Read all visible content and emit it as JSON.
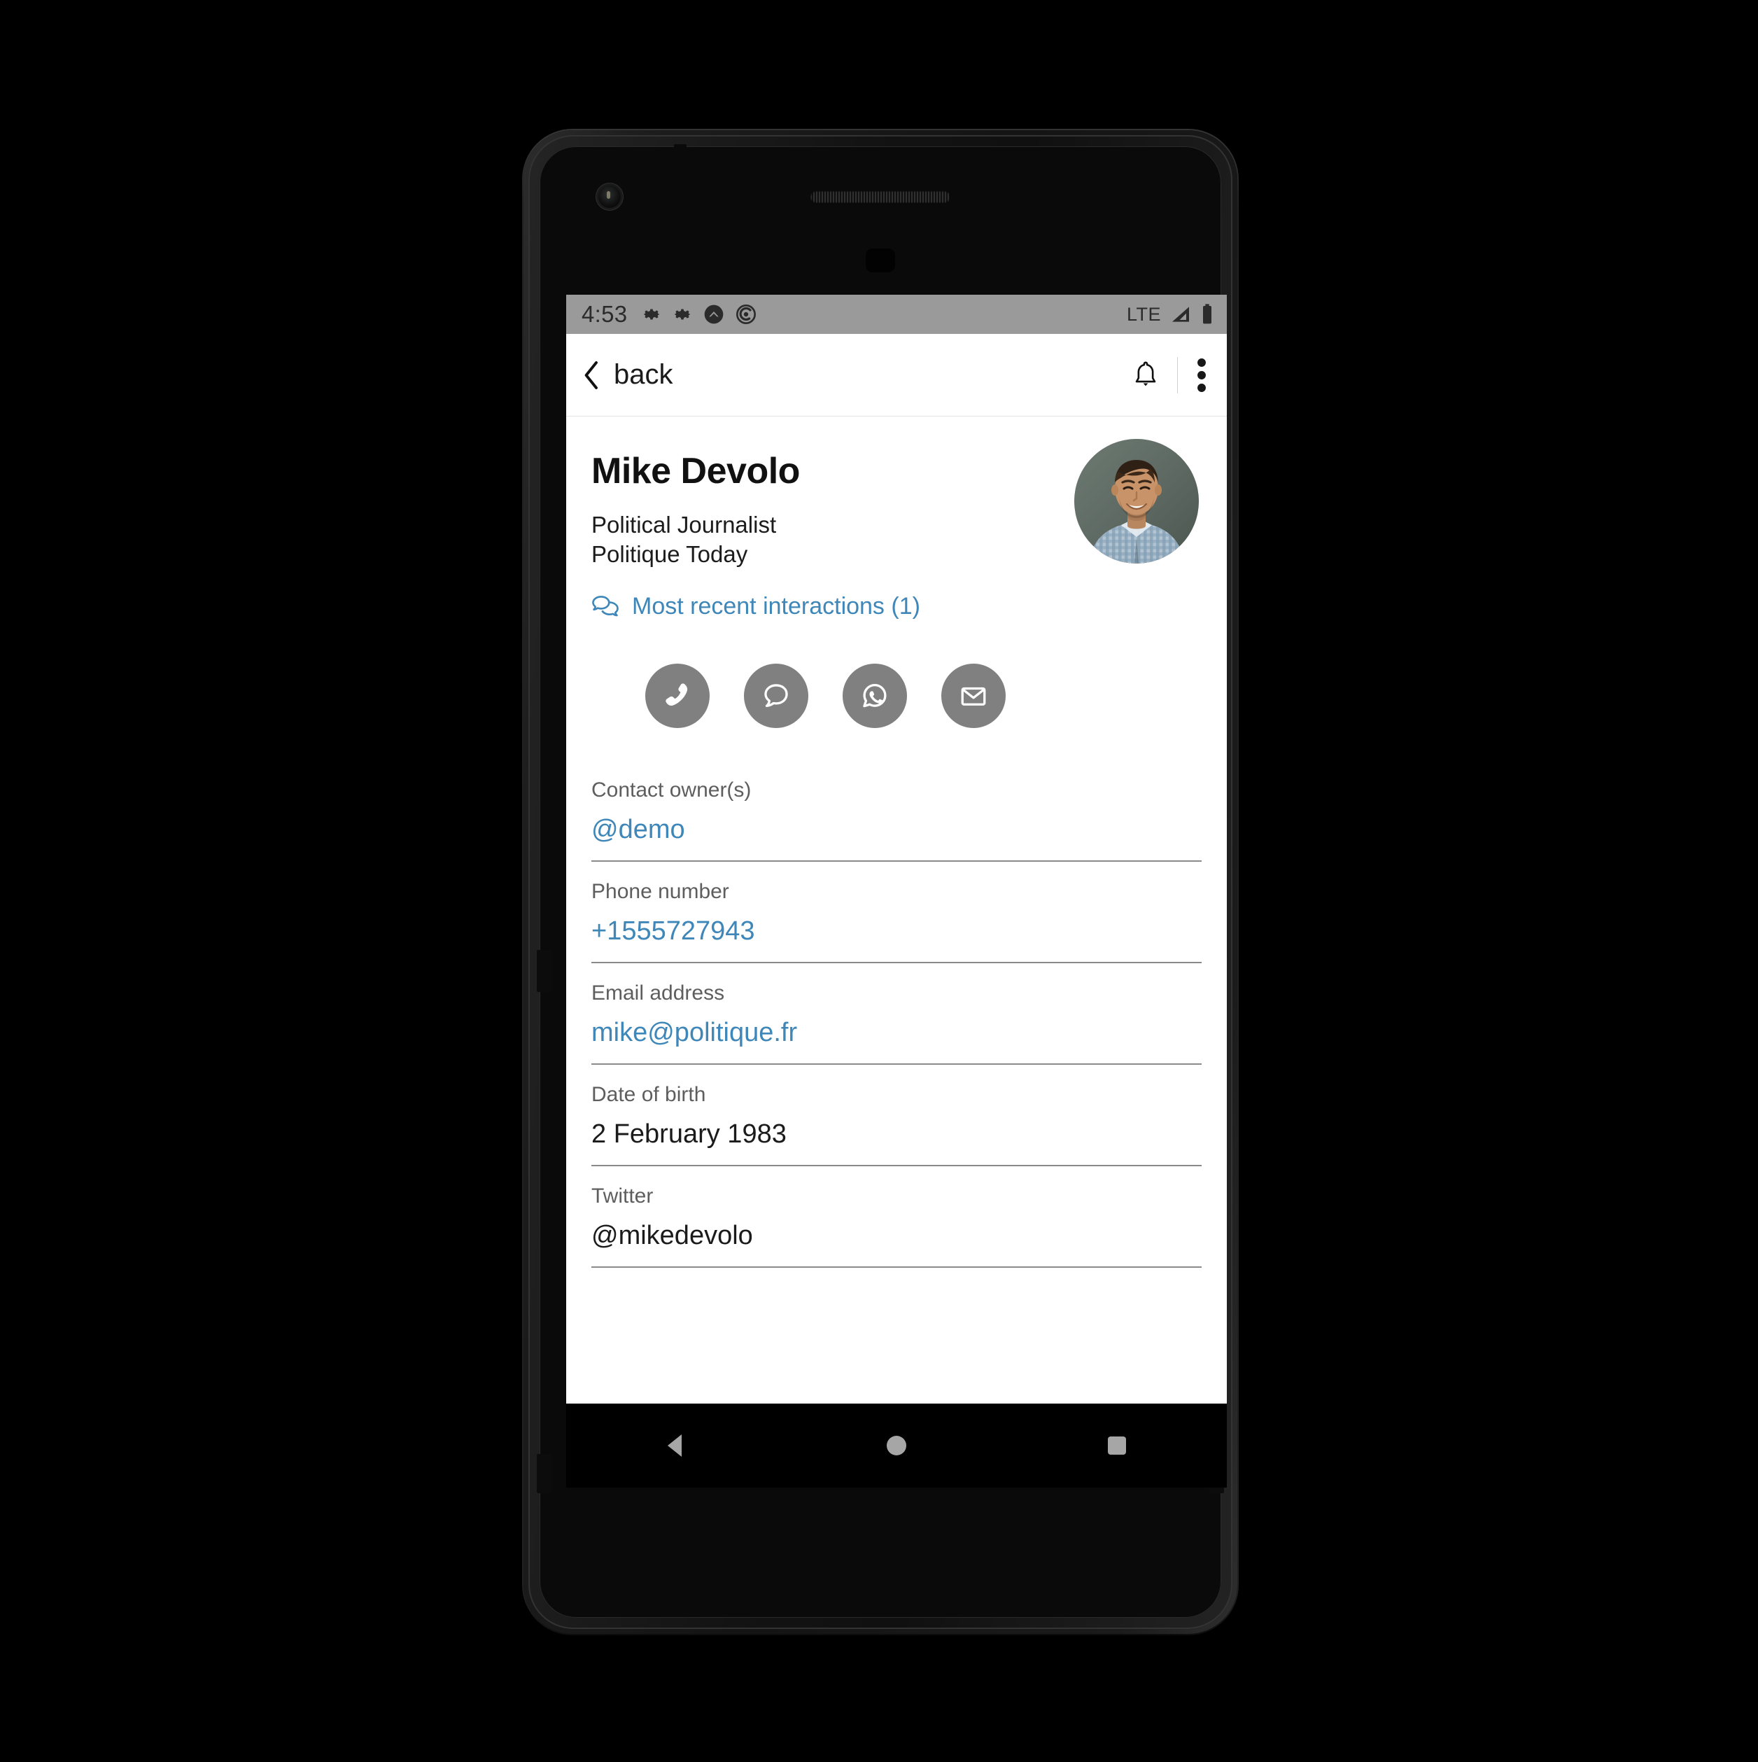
{
  "statusbar": {
    "time": "4:53",
    "icons_left": [
      "gear-icon",
      "gear-icon",
      "chevron-up-circle-icon",
      "swirl-circle-icon"
    ],
    "network_label": "LTE",
    "icons_right": [
      "signal-icon",
      "battery-icon"
    ],
    "background_color": "#9a9a9a"
  },
  "appbar": {
    "back_label": "back",
    "back_icon": "chevron-left-icon",
    "notification_icon": "bell-icon",
    "overflow_icon": "more-vertical-icon"
  },
  "profile": {
    "name": "Mike Devolo",
    "role": "Political Journalist",
    "company": "Politique Today",
    "interactions_label": "Most recent interactions (1)",
    "interactions_icon": "chat-bubbles-icon",
    "avatar_alt": "Mike Devolo profile photo",
    "link_color": "#3e87b8"
  },
  "actions": [
    {
      "name": "call-button",
      "icon": "phone-icon"
    },
    {
      "name": "message-button",
      "icon": "message-bubble-icon"
    },
    {
      "name": "whatsapp-button",
      "icon": "whatsapp-icon"
    },
    {
      "name": "email-button",
      "icon": "envelope-icon"
    }
  ],
  "fields": [
    {
      "label": "Contact owner(s)",
      "value": "@demo",
      "is_link": true
    },
    {
      "label": "Phone number",
      "value": "+1555727943",
      "is_link": true
    },
    {
      "label": "Email address",
      "value": "mike@politique.fr",
      "is_link": true
    },
    {
      "label": "Date of birth",
      "value": "2 February 1983",
      "is_link": false
    },
    {
      "label": "Twitter",
      "value": "@mikedevolo",
      "is_link": false
    }
  ],
  "navbar": {
    "back": "nav-back-icon",
    "home": "nav-home-icon",
    "recents": "nav-recents-icon"
  }
}
